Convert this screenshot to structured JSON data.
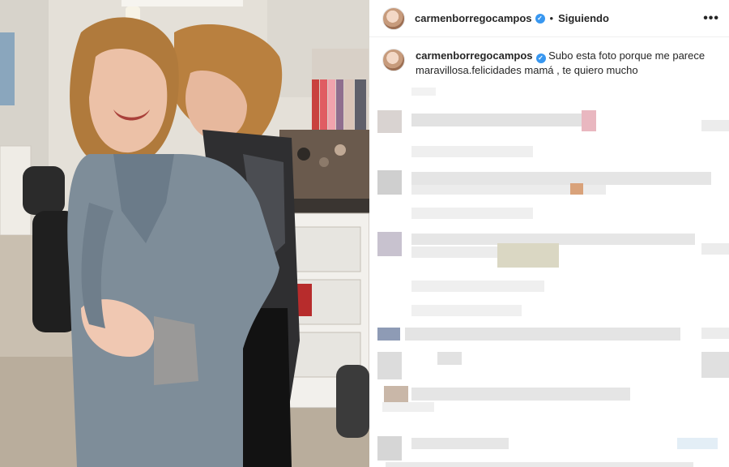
{
  "post": {
    "author": "carmenborregocampos",
    "separator": "•",
    "follow_status": "Siguiendo",
    "more_icon": "more-horizontal-icon",
    "caption": "Subo esta foto porque me parece maravillosa.felicidades mamá , te quiero mucho"
  },
  "colors": {
    "verified": "#3897f0",
    "text": "#262626",
    "divider": "#efefef"
  }
}
